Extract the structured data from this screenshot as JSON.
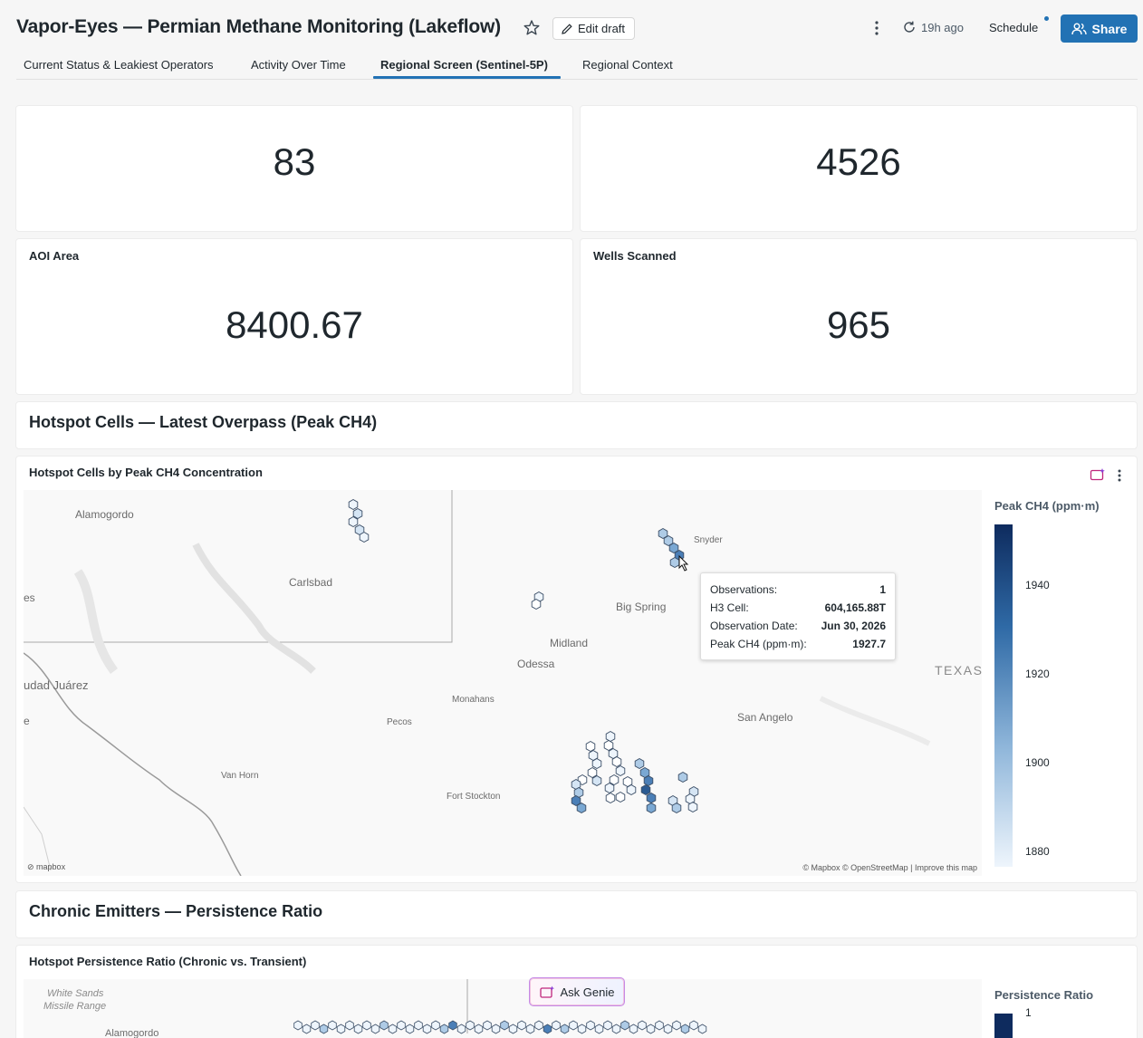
{
  "header": {
    "title": "Vapor-Eyes — Permian Methane Monitoring (Lakeflow)",
    "edit_draft_label": "Edit draft",
    "refresh_label": "19h ago",
    "schedule_label": "Schedule",
    "share_label": "Share"
  },
  "tabs": [
    {
      "label": "Current Status & Leakiest Operators",
      "active": false
    },
    {
      "label": "Activity Over Time",
      "active": false
    },
    {
      "label": "Regional Screen (Sentinel-5P)",
      "active": true
    },
    {
      "label": "Regional Context",
      "active": false
    }
  ],
  "counters": [
    {
      "label": "",
      "value": "83"
    },
    {
      "label": "",
      "value": "4526"
    },
    {
      "label": "AOI Area",
      "value": "8400.67"
    },
    {
      "label": "Wells Scanned",
      "value": "965"
    }
  ],
  "sections": {
    "hotspot_title": "Hotspot Cells — Latest Overpass (Peak CH4)",
    "chronic_title": "Chronic Emitters — Persistence Ratio"
  },
  "hotspot_map": {
    "title": "Hotspot Cells by Peak CH4 Concentration",
    "places": [
      "Alamogordo",
      "Carlsbad",
      "es",
      "udad Juárez",
      "e",
      "Snyder",
      "Big Spring",
      "Midland",
      "Odessa",
      "Monahans",
      "Pecos",
      "San Angelo",
      "Van Horn",
      "Fort Stockton",
      "TEXAS"
    ],
    "attribution": "© Mapbox © OpenStreetMap | Improve this map",
    "mapbox_logo": "mapbox",
    "tooltip": {
      "rows": [
        {
          "label": "Observations:",
          "value": "1"
        },
        {
          "label": "H3 Cell:",
          "value": "604,165.88T"
        },
        {
          "label": "Observation Date:",
          "value": "Jun 30, 2026"
        },
        {
          "label": "Peak CH4 (ppm·m):",
          "value": "1927.7"
        }
      ]
    },
    "legend": {
      "title": "Peak CH4 (ppm·m)",
      "ticks": [
        "1940",
        "1920",
        "1900",
        "1880"
      ],
      "color_high": "#0e2b5e",
      "color_low": "#eef5fc"
    }
  },
  "persistence_map": {
    "title": "Hotspot Persistence Ratio (Chronic vs. Transient)",
    "places": [
      "White Sands",
      "Missile Range",
      "Alamogordo"
    ],
    "legend": {
      "title": "Persistence Ratio",
      "ticks": [
        "1"
      ]
    }
  },
  "ask_genie_label": "Ask Genie",
  "colors": {
    "accent": "#2272b4",
    "background": "#f6f6f6"
  }
}
